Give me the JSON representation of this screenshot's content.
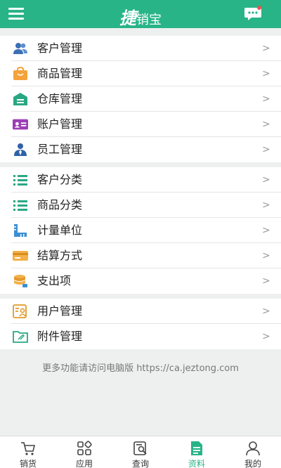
{
  "header": {
    "logo_main": "捷",
    "logo_rest": "销宝",
    "menu_icon": "menu-icon",
    "chat_icon": "chat-icon",
    "brand_color": "#28b487"
  },
  "groups": [
    {
      "items": [
        {
          "label": "客户管理",
          "icon": "customers-icon"
        },
        {
          "label": "商品管理",
          "icon": "shopping-bag-icon"
        },
        {
          "label": "仓库管理",
          "icon": "warehouse-icon"
        },
        {
          "label": "账户管理",
          "icon": "account-card-icon"
        },
        {
          "label": "员工管理",
          "icon": "employee-icon"
        }
      ]
    },
    {
      "items": [
        {
          "label": "客户分类",
          "icon": "list-icon"
        },
        {
          "label": "商品分类",
          "icon": "list-icon"
        },
        {
          "label": "计量单位",
          "icon": "ruler-icon"
        },
        {
          "label": "结算方式",
          "icon": "card-icon"
        },
        {
          "label": "支出项",
          "icon": "coins-icon"
        }
      ]
    },
    {
      "items": [
        {
          "label": "用户管理",
          "icon": "user-card-icon"
        },
        {
          "label": "附件管理",
          "icon": "folder-icon"
        }
      ]
    }
  ],
  "chevron": ">",
  "footer_note": "更多功能请访问电脑版 https://ca.jeztong.com",
  "tabs": [
    {
      "label": "销货",
      "icon": "cart-icon"
    },
    {
      "label": "应用",
      "icon": "apps-icon"
    },
    {
      "label": "查询",
      "icon": "search-doc-icon"
    },
    {
      "label": "资料",
      "icon": "document-icon",
      "active": true
    },
    {
      "label": "我的",
      "icon": "person-icon"
    }
  ]
}
